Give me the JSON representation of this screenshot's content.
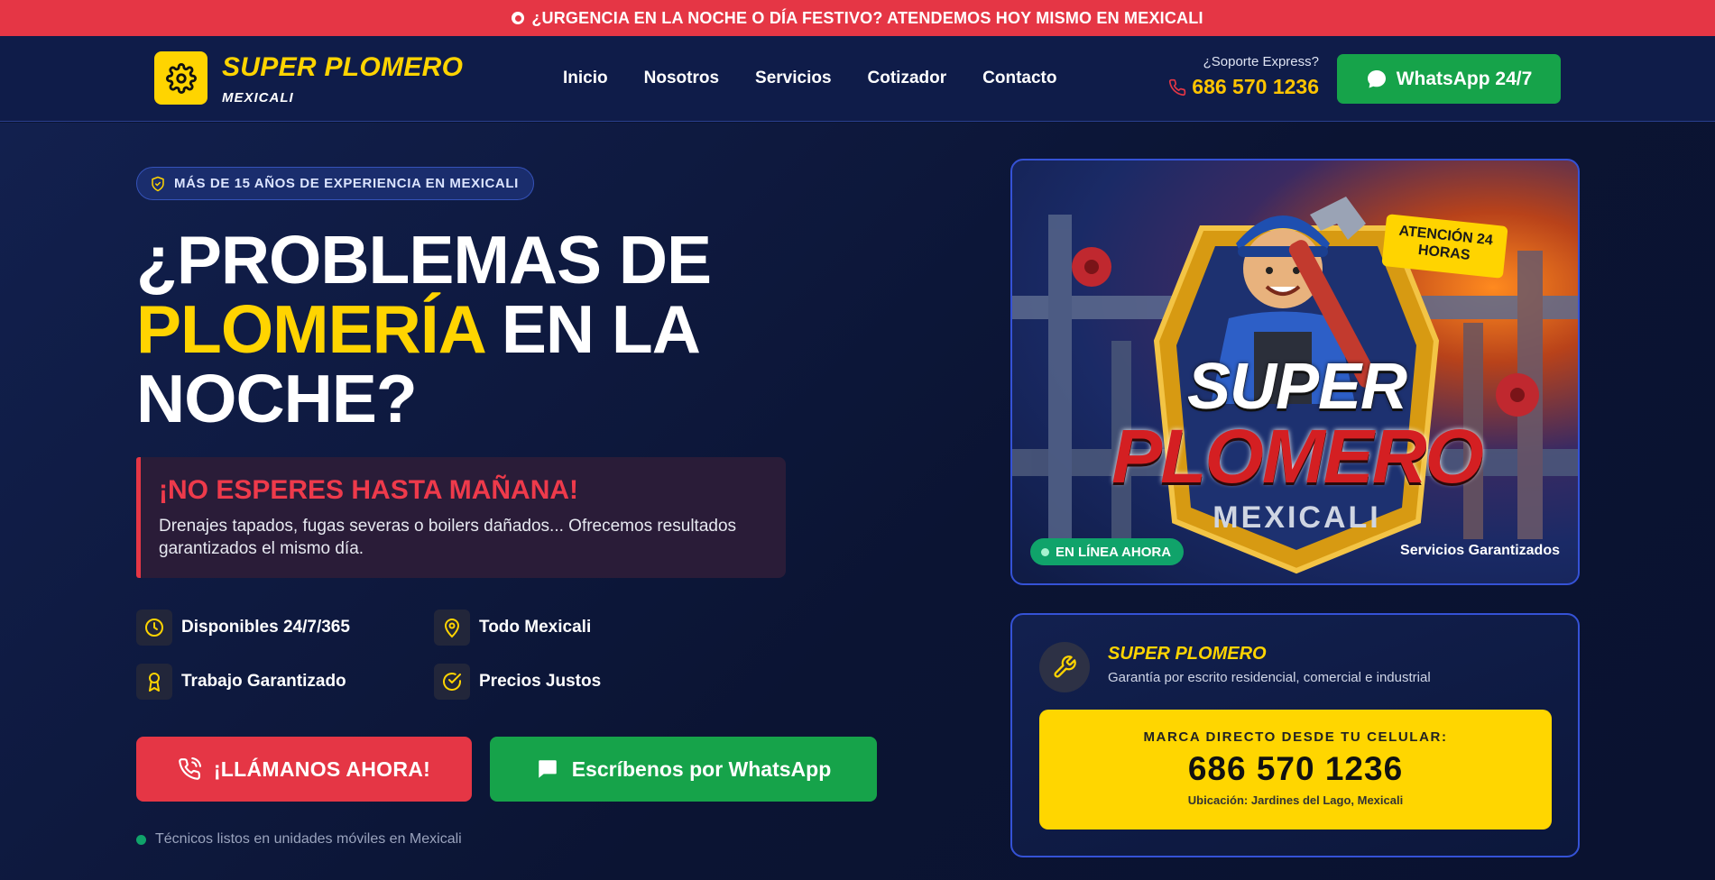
{
  "top_banner": {
    "text": "¿URGENCIA EN LA NOCHE O DÍA FESTIVO? ATENDEMOS HOY MISMO EN MEXICALI"
  },
  "header": {
    "brand_name": "SUPER PLOMERO",
    "brand_city": "MEXICALI",
    "logo_icon": "gear-icon",
    "nav": [
      "Inicio",
      "Nosotros",
      "Servicios",
      "Cotizador",
      "Contacto"
    ],
    "support_label": "¿Soporte Express?",
    "support_phone": "686 570 1236",
    "whatsapp_button": "WhatsApp 24/7"
  },
  "hero": {
    "badge": "MÁS DE 15 AÑOS DE EXPERIENCIA EN MEXICALI",
    "headline_part1": "¿PROBLEMAS DE",
    "headline_highlight": "PLOMERÍA",
    "headline_part2": "EN LA",
    "headline_part3": "NOCHE?",
    "alert_title": "¡NO ESPERES HASTA MAÑANA!",
    "alert_body": "Drenajes tapados, fugas severas o boilers dañados... Ofrecemos resultados garantizados el mismo día.",
    "features": [
      {
        "icon": "clock-icon",
        "label": "Disponibles 24/7/365"
      },
      {
        "icon": "map-pin-icon",
        "label": "Todo Mexicali"
      },
      {
        "icon": "award-icon",
        "label": "Trabajo Garantizado"
      },
      {
        "icon": "check-circle-icon",
        "label": "Precios Justos"
      }
    ],
    "call_button": "¡LLÁMANOS AHORA!",
    "whatsapp_button": "Escríbenos por WhatsApp",
    "technicians_note": "Técnicos listos en unidades móviles en Mexicali"
  },
  "image_card": {
    "badge_attention": "ATENCIÓN 24 HORAS",
    "logo_line1": "SUPER",
    "logo_line2": "PLOMERO",
    "logo_line3": "MEXICALI",
    "online_status": "EN LÍNEA AHORA",
    "caption": "Servicios Garantizados"
  },
  "info_card": {
    "title": "SUPER PLOMERO",
    "subtitle": "Garantía por escrito residencial, comercial e industrial",
    "phone_label": "MARCA DIRECTO DESDE TU CELULAR:",
    "phone_number": "686 570 1236",
    "location": "Ubicación: Jardines del Lago, Mexicali"
  },
  "colors": {
    "accent_yellow": "#ffd400",
    "accent_red": "#e53645",
    "whatsapp_green": "#16a34a",
    "navy": "#0f1c49"
  }
}
